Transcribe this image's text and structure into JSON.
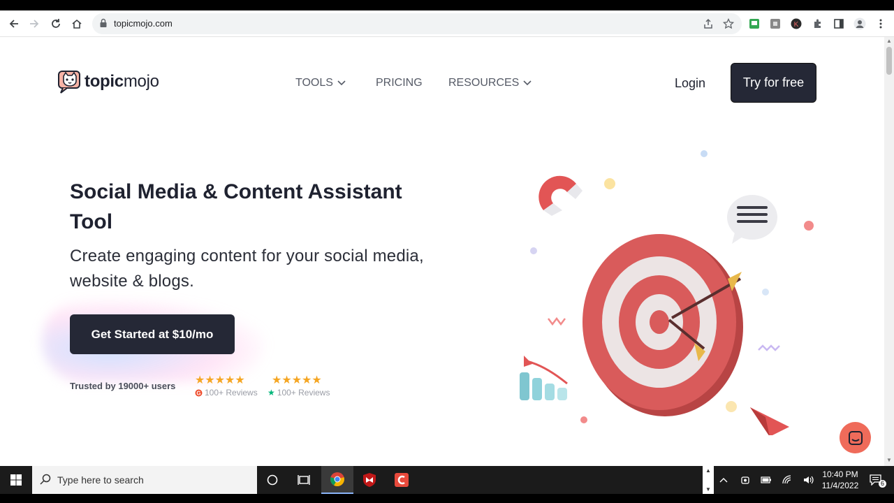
{
  "browser": {
    "url": "topicmojo.com"
  },
  "site": {
    "logo_text_bold": "topic",
    "logo_text_rest": "mojo",
    "nav": [
      {
        "label": "TOOLS",
        "dropdown": true
      },
      {
        "label": "PRICING",
        "dropdown": false
      },
      {
        "label": "RESOURCES",
        "dropdown": true
      }
    ],
    "login_label": "Login",
    "try_label": "Try for free"
  },
  "hero": {
    "title": "Social Media & Content Assistant Tool",
    "subtitle": "Create engaging content for your social media, website & blogs.",
    "cta_label": "Get Started at $10/mo",
    "trusted": "Trusted by 19000+ users",
    "reviews": [
      {
        "stars": "★★★★★",
        "count": "100+ Reviews",
        "source_icon": "g2-icon"
      },
      {
        "stars": "★★★★★",
        "count": "100+ Reviews",
        "source_icon": "trustpilot-star-icon"
      }
    ]
  },
  "taskbar": {
    "search_placeholder": "Type here to search",
    "time": "10:40 PM",
    "date": "11/4/2022",
    "notification_count": "6"
  },
  "colors": {
    "dark_button": "#252836",
    "star": "#f5a623",
    "chat_bubble": "#ef6b5a",
    "target_red": "#d95b5b"
  }
}
